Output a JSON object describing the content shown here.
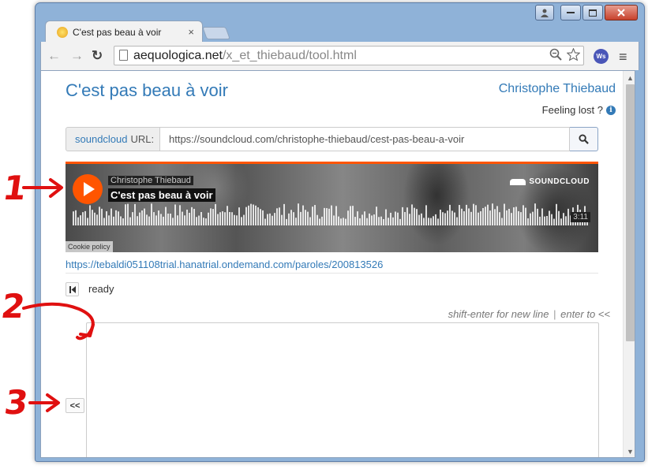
{
  "tab": {
    "title": "C'est pas beau à voir",
    "close": "×"
  },
  "omnibox": {
    "host": "aequologica.net",
    "path": "/x_et_thiebaud/tool.html"
  },
  "extension": {
    "label": "Ws"
  },
  "page": {
    "title": "C'est pas beau à voir",
    "author": "Christophe Thiebaud",
    "feeling_lost": "Feeling lost ?",
    "info_glyph": "i"
  },
  "search": {
    "addon_brand": "soundcloud",
    "addon_label": "URL:",
    "value": "https://soundcloud.com/christophe-thiebaud/cest-pas-beau-a-voir"
  },
  "player": {
    "user": "Christophe Thiebaud",
    "track": "C'est pas beau à voir",
    "brand": "SOUNDCLOUD",
    "duration": "3:11",
    "cookie_policy": "Cookie policy"
  },
  "paroles_link": "https://tebaldi051108trial.hanatrial.ondemand.com/paroles/200813526",
  "status": "ready",
  "hint": {
    "newline": "shift-enter for new line",
    "separator": "|",
    "enter": "enter to <<"
  },
  "buttons": {
    "first": "⏮",
    "insert": "<<"
  },
  "annotations": [
    "1",
    "2",
    "3"
  ],
  "colors": {
    "link": "#337ab7",
    "soundcloud": "#ff5500",
    "annotation": "#e01010"
  }
}
